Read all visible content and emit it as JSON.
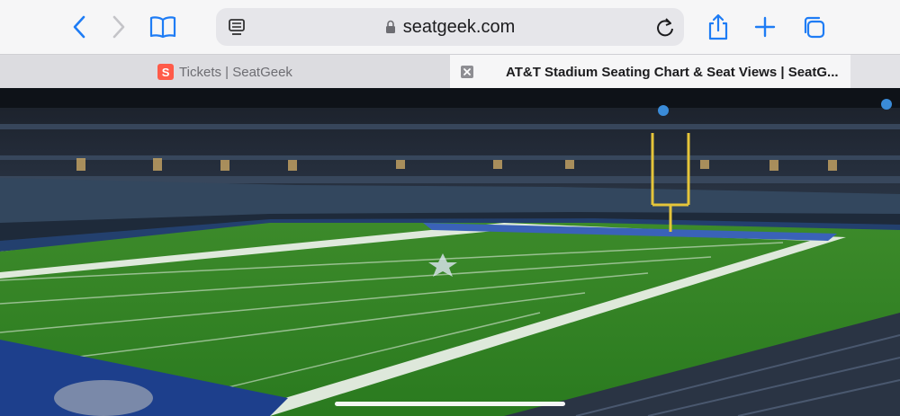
{
  "toolbar": {
    "back_icon": "chevron-left-icon",
    "forward_icon": "chevron-right-icon",
    "bookmarks_icon": "book-icon",
    "share_icon": "share-icon",
    "new_tab_icon": "plus-icon",
    "tabs_icon": "tabs-icon",
    "accent_color": "#1e7cf5"
  },
  "address_bar": {
    "url": "seatgeek.com",
    "reader_icon": "reader-icon",
    "lock_icon": "lock-icon",
    "reload_icon": "reload-icon"
  },
  "tabs": [
    {
      "favicon": "S",
      "title": "Tickets | SeatGeek",
      "active": false
    },
    {
      "title": "AT&T Stadium Seating Chart & Seat Views | SeatG...",
      "active": true
    }
  ],
  "content": {
    "description_icon": "stadium-photo"
  }
}
